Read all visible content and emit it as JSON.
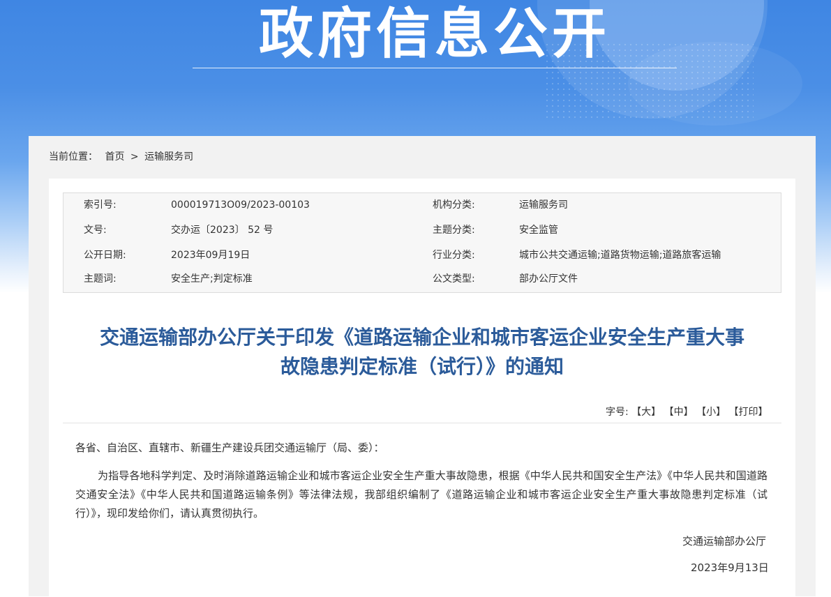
{
  "banner": {
    "title": "政府信息公开"
  },
  "breadcrumb": {
    "label": "当前位置：",
    "home": "首页",
    "separator": ">",
    "current": "运输服务司"
  },
  "meta": {
    "index_label": "索引号:",
    "index_value": "000019713O09/2023-00103",
    "org_label": "机构分类:",
    "org_value": "运输服务司",
    "docno_label": "文号:",
    "docno_value": "交办运〔2023〕 52 号",
    "topic_label": "主题分类:",
    "topic_value": "安全监管",
    "date_label": "公开日期:",
    "date_value": "2023年09月19日",
    "industry_label": "行业分类:",
    "industry_value": "城市公共交通运输;道路货物运输;道路旅客运输",
    "keyword_label": "主题词:",
    "keyword_value": "安全生产;判定标准",
    "doctype_label": "公文类型:",
    "doctype_value": "部办公厅文件"
  },
  "article": {
    "title_line1": "交通运输部办公厅关于印发《道路运输企业和城市客运企业安全生产重大事",
    "title_line2": "故隐患判定标准（试行）》的通知",
    "salutation": "各省、自治区、直辖市、新疆生产建设兵团交通运输厅（局、委）：",
    "body": "为指导各地科学判定、及时消除道路运输企业和城市客运企业安全生产重大事故隐患，根据《中华人民共和国安全生产法》《中华人民共和国道路交通安全法》《中华人民共和国道路运输条例》等法律法规，我部组织编制了《道路运输企业和城市客运企业安全生产重大事故隐患判定标准（试行）》，现印发给你们，请认真贯彻执行。",
    "signer": "交通运输部办公厅",
    "date": "2023年9月13日"
  },
  "toolbar": {
    "label": "字号:",
    "large": "【大】",
    "medium": "【中】",
    "small": "【小】",
    "print": "【打印】"
  },
  "colors": {
    "banner": "#3f86e3",
    "title": "#2b5b9a"
  }
}
